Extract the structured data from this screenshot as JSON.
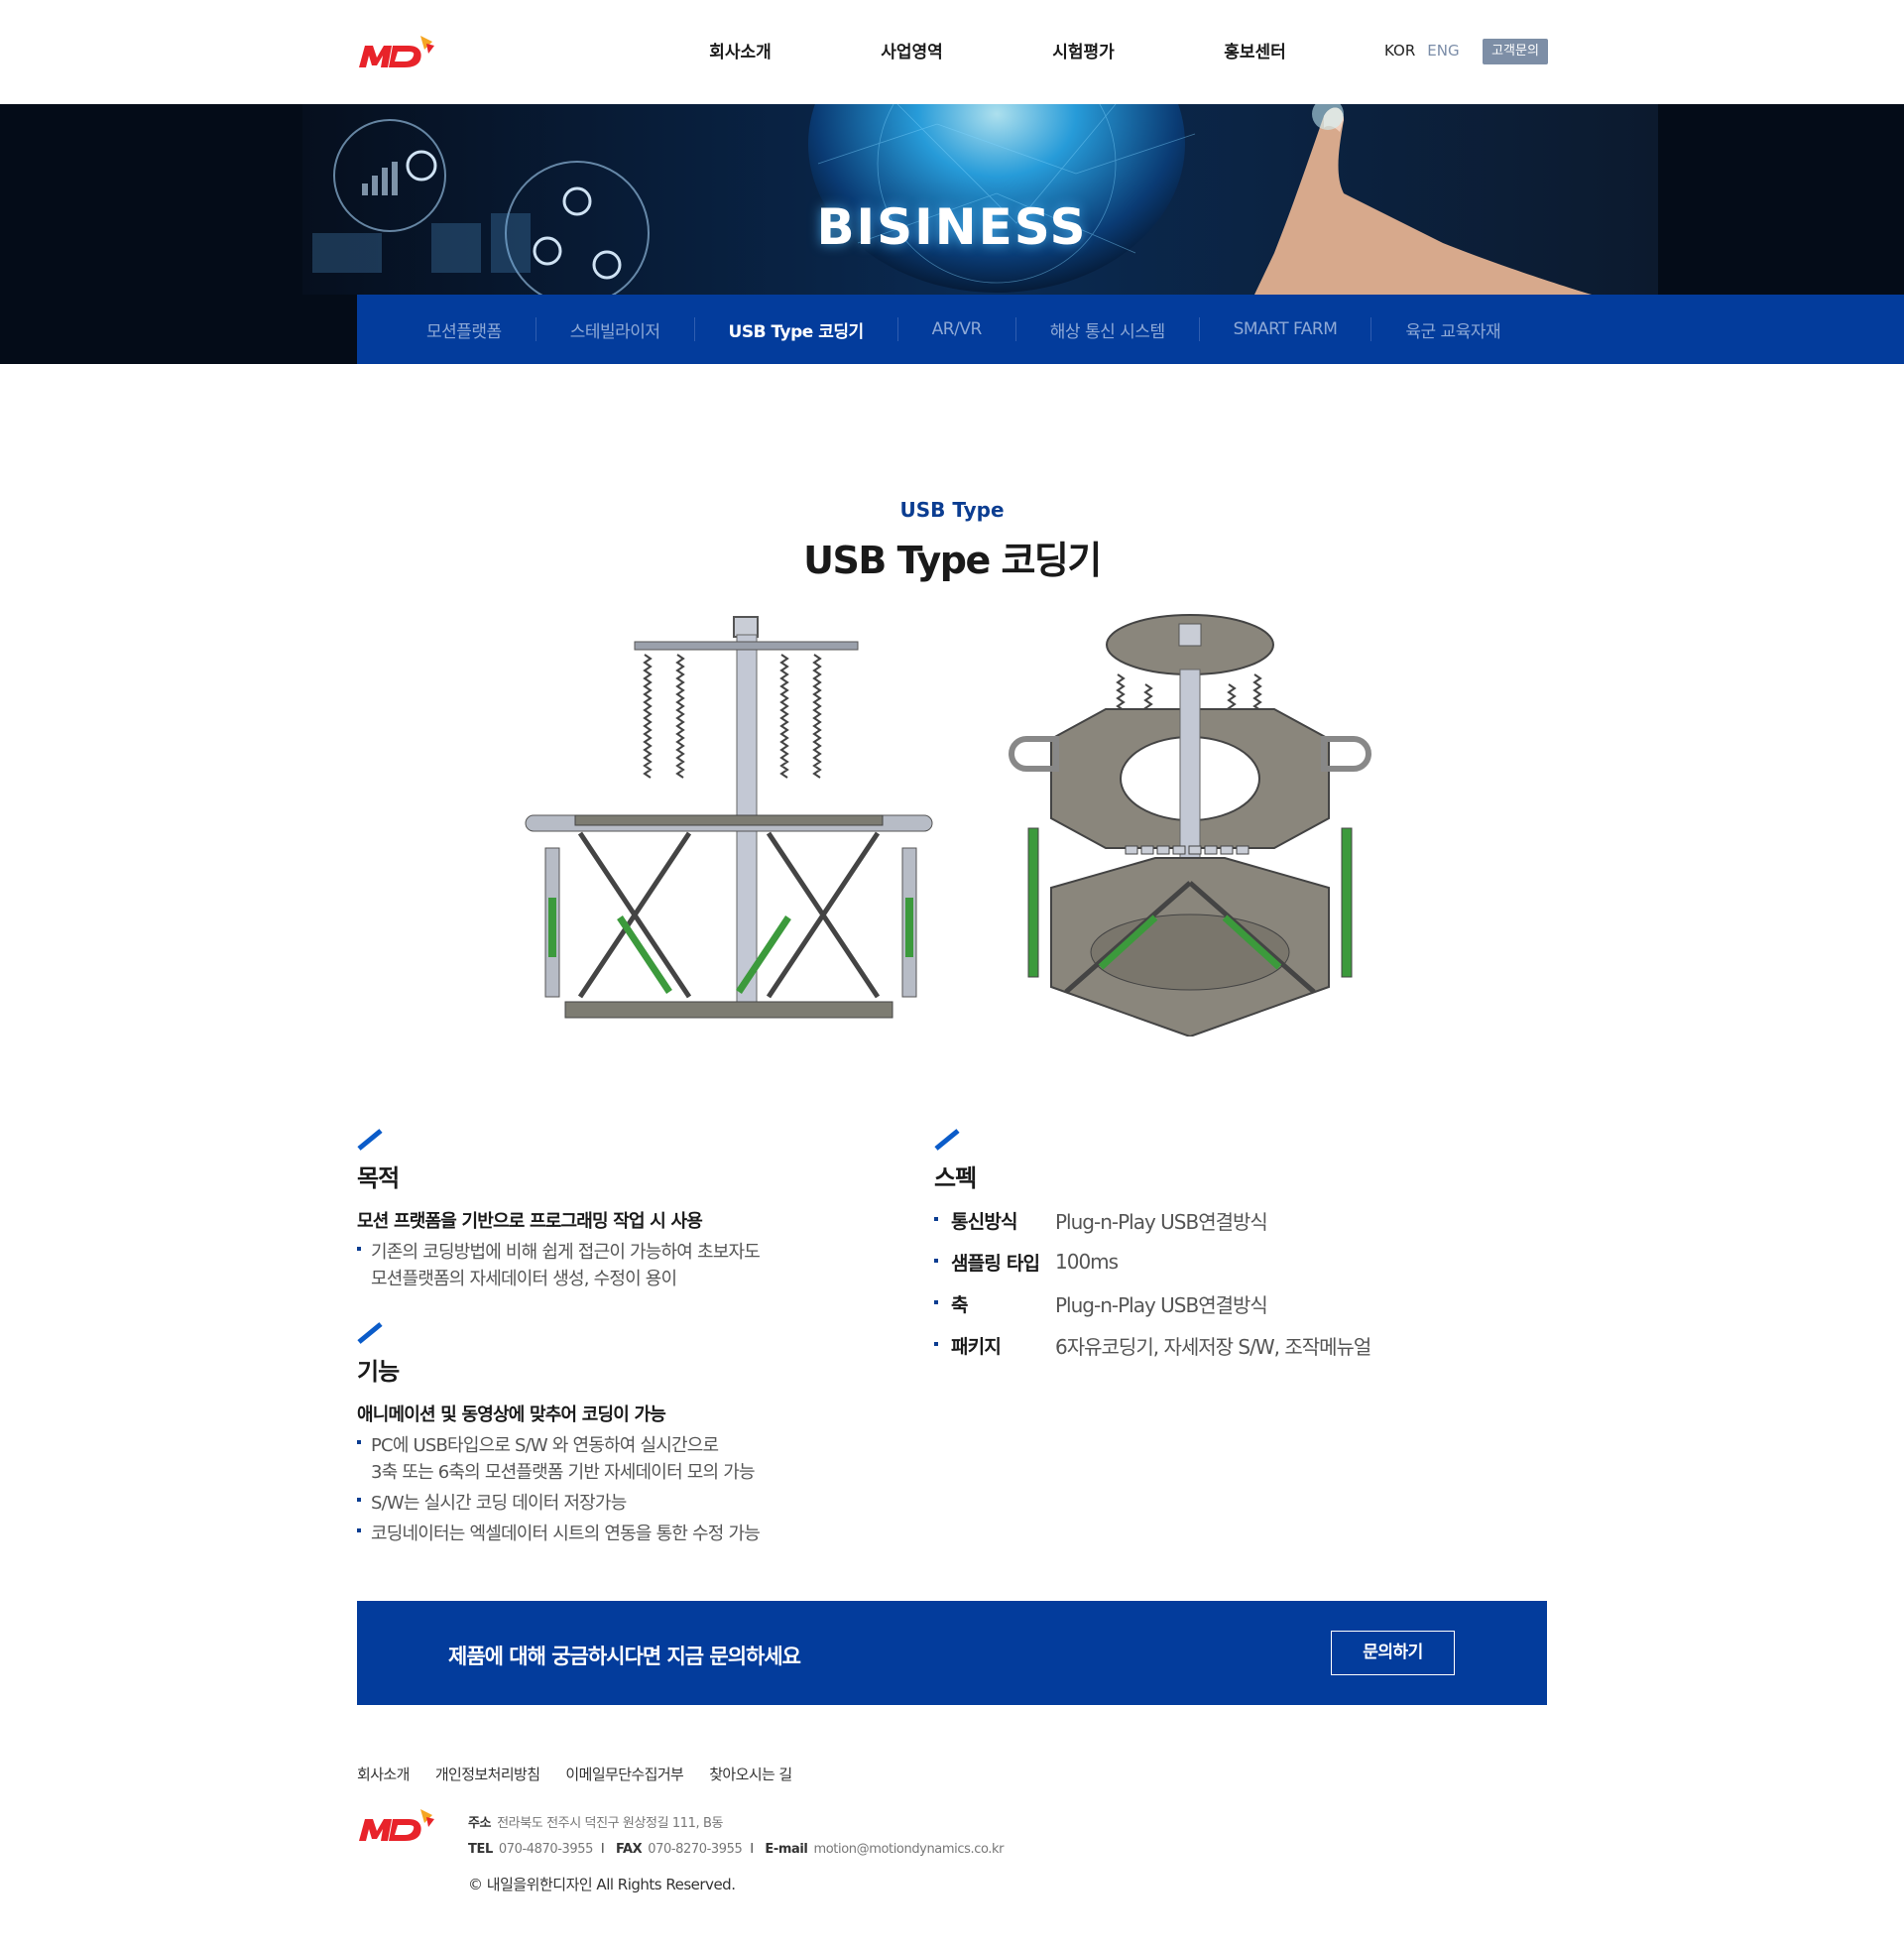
{
  "header": {
    "logo": "MD",
    "nav": [
      "회사소개",
      "사업영역",
      "시험평가",
      "홍보센터"
    ],
    "lang_kor": "KOR",
    "lang_eng": "ENG",
    "cs_button": "고객문의"
  },
  "hero": {
    "title": "BISINESS"
  },
  "subnav": {
    "items": [
      "모션플랫폼",
      "스테빌라이저",
      "USB Type 코딩기",
      "AR/VR",
      "해상 통신 시스템",
      "SMART FARM",
      "육군 교육자재"
    ],
    "active_index": 2
  },
  "product": {
    "eyebrow": "USB Type",
    "title": "USB Type 코딩기"
  },
  "purpose": {
    "heading": "목적",
    "subtitle": "모션 프랫폼을 기반으로 프로그래밍 작업 시 사용",
    "bullets": [
      [
        "기존의 코딩방법에 비해 쉽게 접근이 가능하여 초보자도",
        "모션플랫폼의 자세데이터 생성, 수정이 용이"
      ]
    ]
  },
  "function": {
    "heading": "기능",
    "subtitle": "애니메이션 및 동영상에 맞추어 코딩이 가능",
    "bullets": [
      [
        "PC에 USB타입으로 S/W 와 연동하여 실시간으로",
        "3축 또는 6축의 모션플랫폼 기반 자세데이터 모의 가능"
      ],
      [
        "S/W는 실시간 코딩 데이터 저장가능"
      ],
      [
        "코딩네이터는 엑셀데이터 시트의 연동을 통한 수정 가능"
      ]
    ]
  },
  "spec": {
    "heading": "스펙",
    "rows": [
      {
        "key": "통신방식",
        "value": "Plug-n-Play USB연결방식"
      },
      {
        "key": "샘플링 타입",
        "value": "100ms"
      },
      {
        "key": "축",
        "value": "Plug-n-Play USB연결방식"
      },
      {
        "key": "패키지",
        "value": "6자유코딩기, 자세저장 S/W, 조작메뉴얼"
      }
    ]
  },
  "cta": {
    "text": "제품에 대해 궁금하시다면 지금 문의하세요",
    "button": "문의하기"
  },
  "footer": {
    "links": [
      "회사소개",
      "개인정보처리방침",
      "이메일무단수집거부",
      "찾아오시는 길"
    ],
    "address_label": "주소",
    "address": "전라북도 전주시 덕진구 원상정길 111, B동",
    "tel_label": "TEL",
    "tel": "070-4870-3955",
    "fax_label": "FAX",
    "fax": "070-8270-3955",
    "email_label": "E-mail",
    "email": "motion@motiondynamics.co.kr",
    "copyright": "© 내일을위한디자인  All Rights Reserved."
  },
  "colors": {
    "brand_blue": "#033c9c",
    "logo_red": "#e8232a",
    "logo_orange": "#f5a623"
  }
}
